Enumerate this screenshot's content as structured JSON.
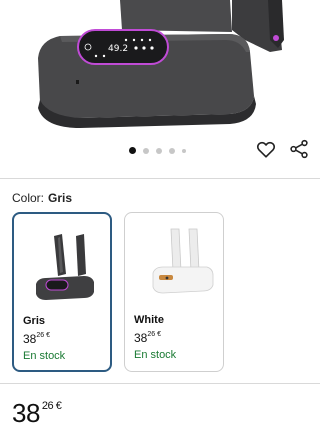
{
  "product_display": {
    "display_readout": "49.2"
  },
  "carousel": {
    "count": 5,
    "active_index": 0
  },
  "actions": {
    "wishlist_icon": "heart-outline-icon",
    "share_icon": "share-icon"
  },
  "color_selector": {
    "label": "Color:",
    "selected_value": "Gris"
  },
  "variants": [
    {
      "name": "Gris",
      "price_int": "38",
      "price_cents": "26 €",
      "stock": "En stock",
      "selected": true,
      "swatch": "#3a3a3c"
    },
    {
      "name": "White",
      "price_int": "38",
      "price_cents": "26 €",
      "stock": "En stock",
      "selected": false,
      "swatch": "#f2f2f2"
    }
  ],
  "price": {
    "int": "38",
    "cents": "26 €"
  },
  "colors": {
    "accent_border": "#2d5b82",
    "in_stock": "#1a7a33",
    "display_glow": "#c04bd6"
  }
}
